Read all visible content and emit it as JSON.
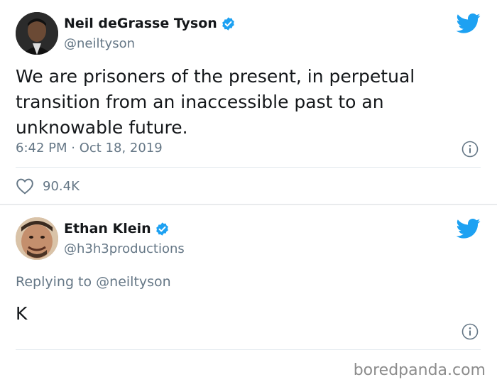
{
  "tweets": [
    {
      "author_name": "Neil deGrasse Tyson",
      "handle": "@neiltyson",
      "text": "We are prisoners of the present, in perpetual transition from an inaccessible past to an unknowable future.",
      "timestamp": "6:42 PM · Oct 18, 2019",
      "likes": "90.4K"
    },
    {
      "author_name": "Ethan Klein",
      "handle": "@h3h3productions",
      "replying_to_prefix": "Replying to",
      "replying_to_handle": "@neiltyson",
      "text": "K"
    }
  ],
  "icons": {
    "verified": "verified-badge-icon",
    "bird": "twitter-bird-icon",
    "info": "info-icon",
    "heart": "heart-icon"
  },
  "colors": {
    "twitter_blue": "#1da1f2",
    "text_primary": "#14171a",
    "text_secondary": "#657786"
  },
  "watermark": "boredpanda.com"
}
